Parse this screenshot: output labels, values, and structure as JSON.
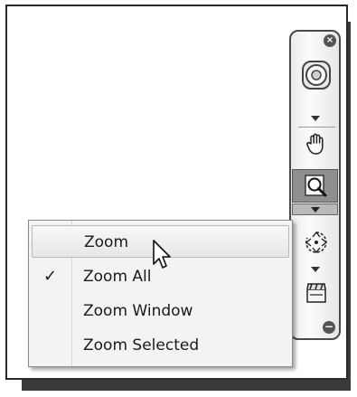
{
  "navbar": {
    "close_glyph": "×",
    "expand_glyph": "−",
    "tools": [
      {
        "name": "steering-wheel",
        "icon": "steering-wheel-icon"
      },
      {
        "name": "pan",
        "icon": "pan-hand-icon"
      },
      {
        "name": "zoom",
        "icon": "zoom-icon",
        "active": true
      },
      {
        "name": "orbit",
        "icon": "orbit-icon"
      },
      {
        "name": "showmotion",
        "icon": "showmotion-icon"
      }
    ]
  },
  "menu": {
    "items": [
      {
        "label": "Zoom",
        "checked": false,
        "hovered": true
      },
      {
        "label": "Zoom All",
        "checked": true,
        "hovered": false
      },
      {
        "label": "Zoom Window",
        "checked": false,
        "hovered": false
      },
      {
        "label": "Zoom Selected",
        "checked": false,
        "hovered": false
      }
    ],
    "check_glyph": "✓"
  },
  "colors": {
    "frame": "#2a2a2a",
    "shadow": "#3a3a3a",
    "active_tool": "#8f8f8f",
    "menu_bg": "#f3f3f3"
  }
}
